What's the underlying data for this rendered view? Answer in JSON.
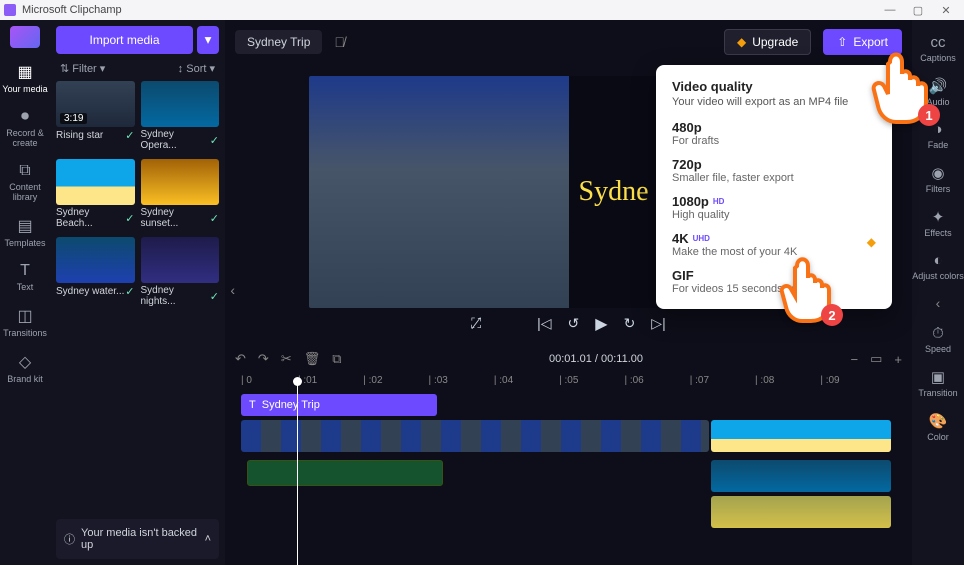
{
  "app_title": "Microsoft Clipchamp",
  "nav": [
    {
      "label": "Your media",
      "active": true
    },
    {
      "label": "Record & create"
    },
    {
      "label": "Content library"
    },
    {
      "label": "Templates"
    },
    {
      "label": "Text"
    },
    {
      "label": "Transitions"
    },
    {
      "label": "Brand kit"
    }
  ],
  "media_panel": {
    "import_label": "Import media",
    "filter_label": "Filter",
    "sort_label": "Sort",
    "items": [
      {
        "name": "Rising star",
        "duration": "3:19"
      },
      {
        "name": "Sydney Opera..."
      },
      {
        "name": "Sydney Beach..."
      },
      {
        "name": "Sydney sunset..."
      },
      {
        "name": "Sydney water..."
      },
      {
        "name": "Sydney nights..."
      }
    ],
    "warning": "Your media isn't backed up"
  },
  "topbar": {
    "project_name": "Sydney Trip",
    "upgrade_label": "Upgrade",
    "export_label": "Export"
  },
  "preview": {
    "overlay_text": "Sydne",
    "time_current": "00:01.01",
    "time_total": "00:11.00"
  },
  "timeline": {
    "ticks": [
      "0",
      ":01",
      ":02",
      ":03",
      ":04",
      ":05",
      ":06",
      ":07",
      ":08",
      ":09"
    ],
    "text_clip_label": "Sydney Trip"
  },
  "right_rail": [
    {
      "label": "Captions"
    },
    {
      "label": "Audio"
    },
    {
      "label": "Fade"
    },
    {
      "label": "Filters"
    },
    {
      "label": "Effects"
    },
    {
      "label": "Adjust colors"
    },
    {
      "label": "Speed"
    },
    {
      "label": "Transition"
    },
    {
      "label": "Color"
    }
  ],
  "export_popover": {
    "title": "Video quality",
    "subtitle": "Your video will export as an MP4 file",
    "options": [
      {
        "title": "480p",
        "sub": "For drafts"
      },
      {
        "title": "720p",
        "sub": "Smaller file, faster export"
      },
      {
        "title": "1080p",
        "badge": "HD",
        "sub": "High quality"
      },
      {
        "title": "4K",
        "badge": "UHD",
        "sub": "Make the most of your 4K",
        "premium": true
      },
      {
        "title": "GIF",
        "sub": "For videos 15 seconds or less"
      }
    ]
  },
  "annotations": {
    "hand1": "1",
    "hand2": "2"
  }
}
